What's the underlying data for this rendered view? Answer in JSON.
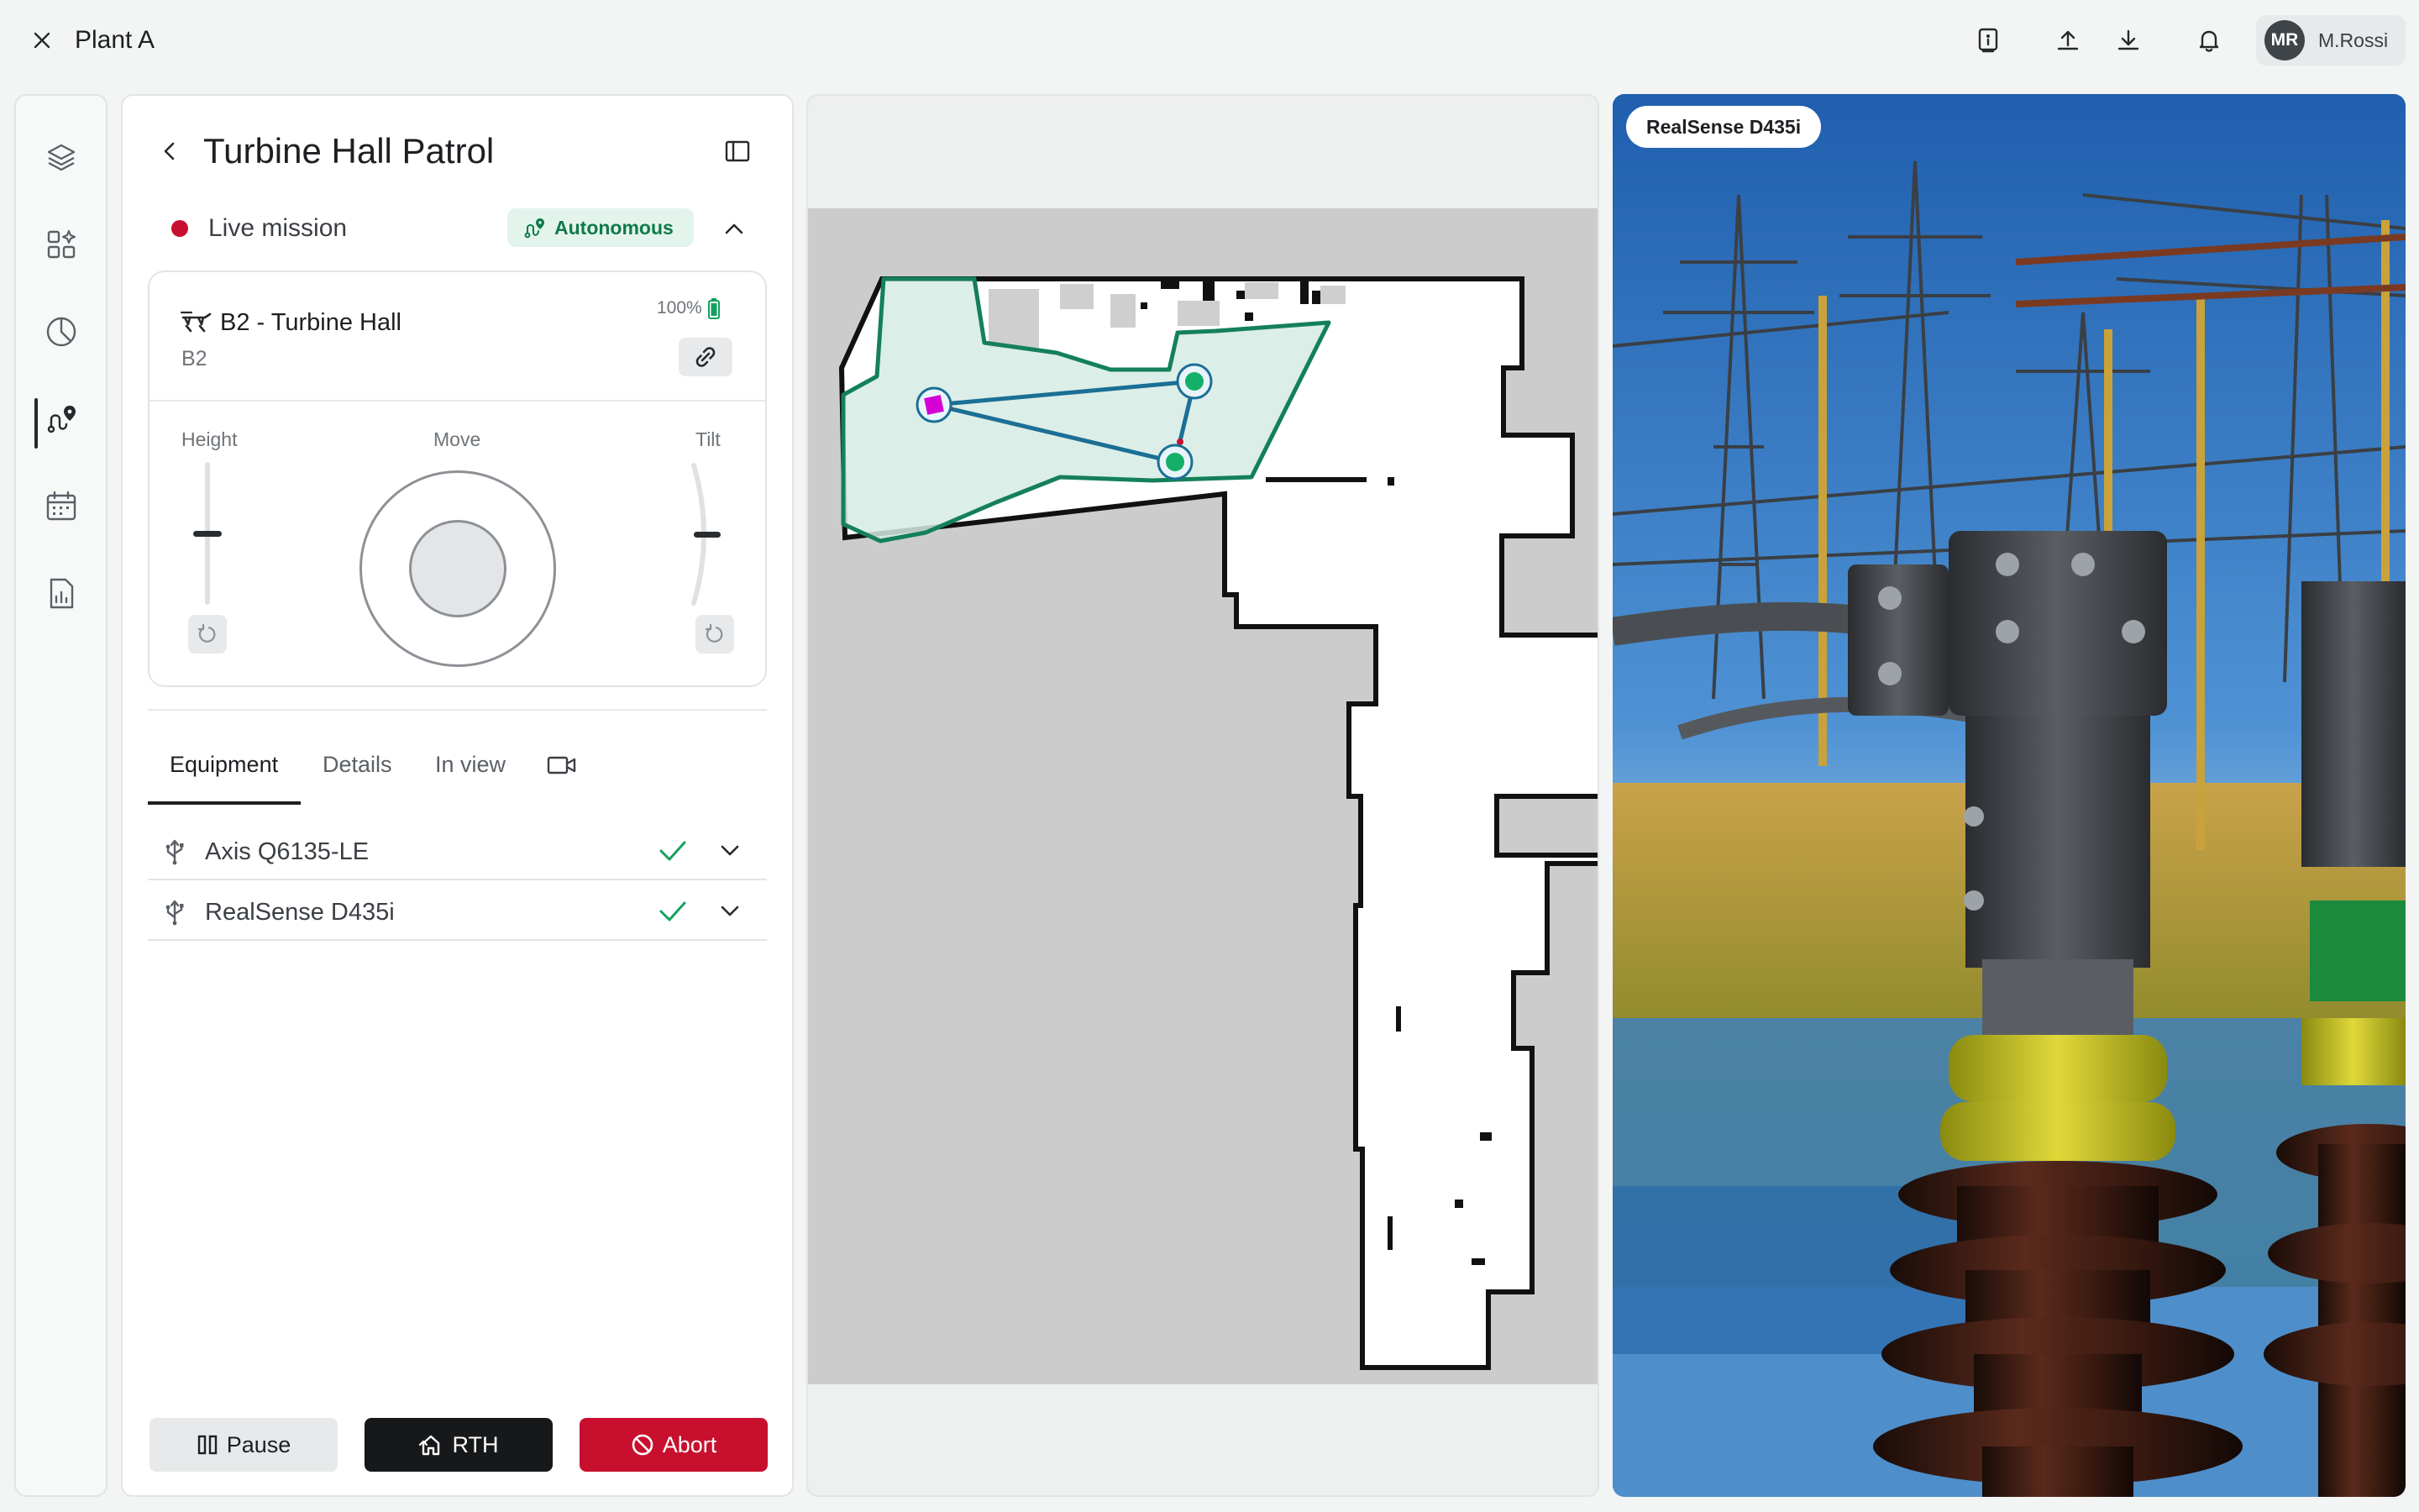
{
  "topbar": {
    "title": "Plant A",
    "user_initials": "MR",
    "user_name": "M.Rossi"
  },
  "rail": {
    "items": [
      "layers-icon",
      "widgets-icon",
      "analytics-icon",
      "missions-icon",
      "calendar-icon",
      "reports-icon"
    ],
    "active_index": 3
  },
  "mission": {
    "title": "Turbine Hall Patrol",
    "status_label": "Live mission",
    "mode_label": "Autonomous",
    "status_color": "#c8102e",
    "mode_color": "#0f7a4a"
  },
  "robot": {
    "name": "B2 - Turbine Hall",
    "id": "B2",
    "battery": "100%"
  },
  "controls": {
    "height_label": "Height",
    "move_label": "Move",
    "tilt_label": "Tilt",
    "height_level": 0.5,
    "tilt_level": 0.5
  },
  "tabs": {
    "equipment": "Equipment",
    "details": "Details",
    "in_view": "In view"
  },
  "equipment": [
    {
      "name": "Axis Q6135-LE",
      "status": "ok"
    },
    {
      "name": "RealSense D435i",
      "status": "ok"
    }
  ],
  "actions": {
    "pause": "Pause",
    "rth": "RTH",
    "abort": "Abort"
  },
  "camera": {
    "label": "RealSense D435i"
  },
  "accent": {
    "zone_fill": "#d6ebe4",
    "zone_stroke": "#14805a",
    "route": "#1b6f95",
    "waypoint": "#14b06a",
    "robot_marker": "#d400d4"
  }
}
